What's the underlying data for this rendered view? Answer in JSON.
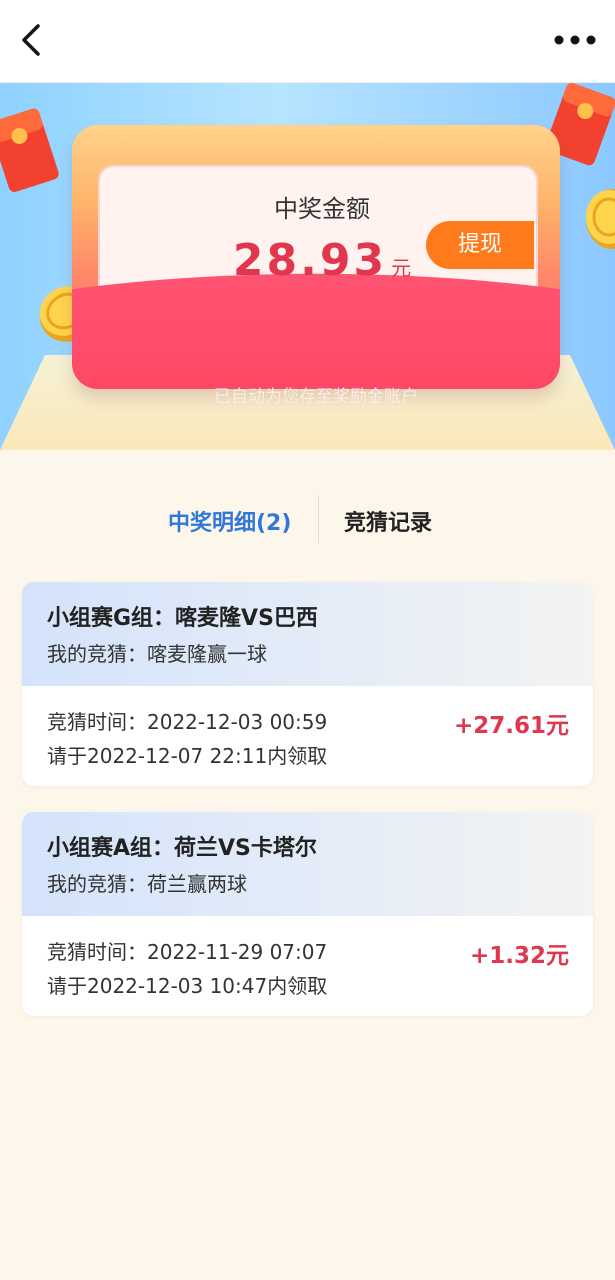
{
  "nav": {
    "back_icon": "chevron-left-icon",
    "more_icon": "more-horizontal-icon"
  },
  "hero": {
    "prize_label": "中奖金额",
    "amount": "28.93",
    "unit": "元",
    "withdraw_label": "提现",
    "auto_note": "已自动为您存至奖励金账户"
  },
  "tabs": {
    "active_label": "中奖明细(2)",
    "record_label": "竞猜记录"
  },
  "records": [
    {
      "title": "小组赛G组：喀麦隆VS巴西",
      "guess": "我的竞猜：喀麦隆赢一球",
      "time": "竞猜时间：2022-12-03 00:59",
      "deadline": "请于2022-12-07 22:11内领取",
      "amount": "+27.61元"
    },
    {
      "title": "小组赛A组：荷兰VS卡塔尔",
      "guess": "我的竞猜：荷兰赢两球",
      "time": "竞猜时间：2022-11-29 07:07",
      "deadline": "请于2022-12-03 10:47内领取",
      "amount": "+1.32元"
    }
  ],
  "colors": {
    "accent_blue": "#2f77d9",
    "prize_red": "#e0364e",
    "withdraw_orange": "#ff7a1a",
    "page_bg": "#fdf7eb"
  }
}
